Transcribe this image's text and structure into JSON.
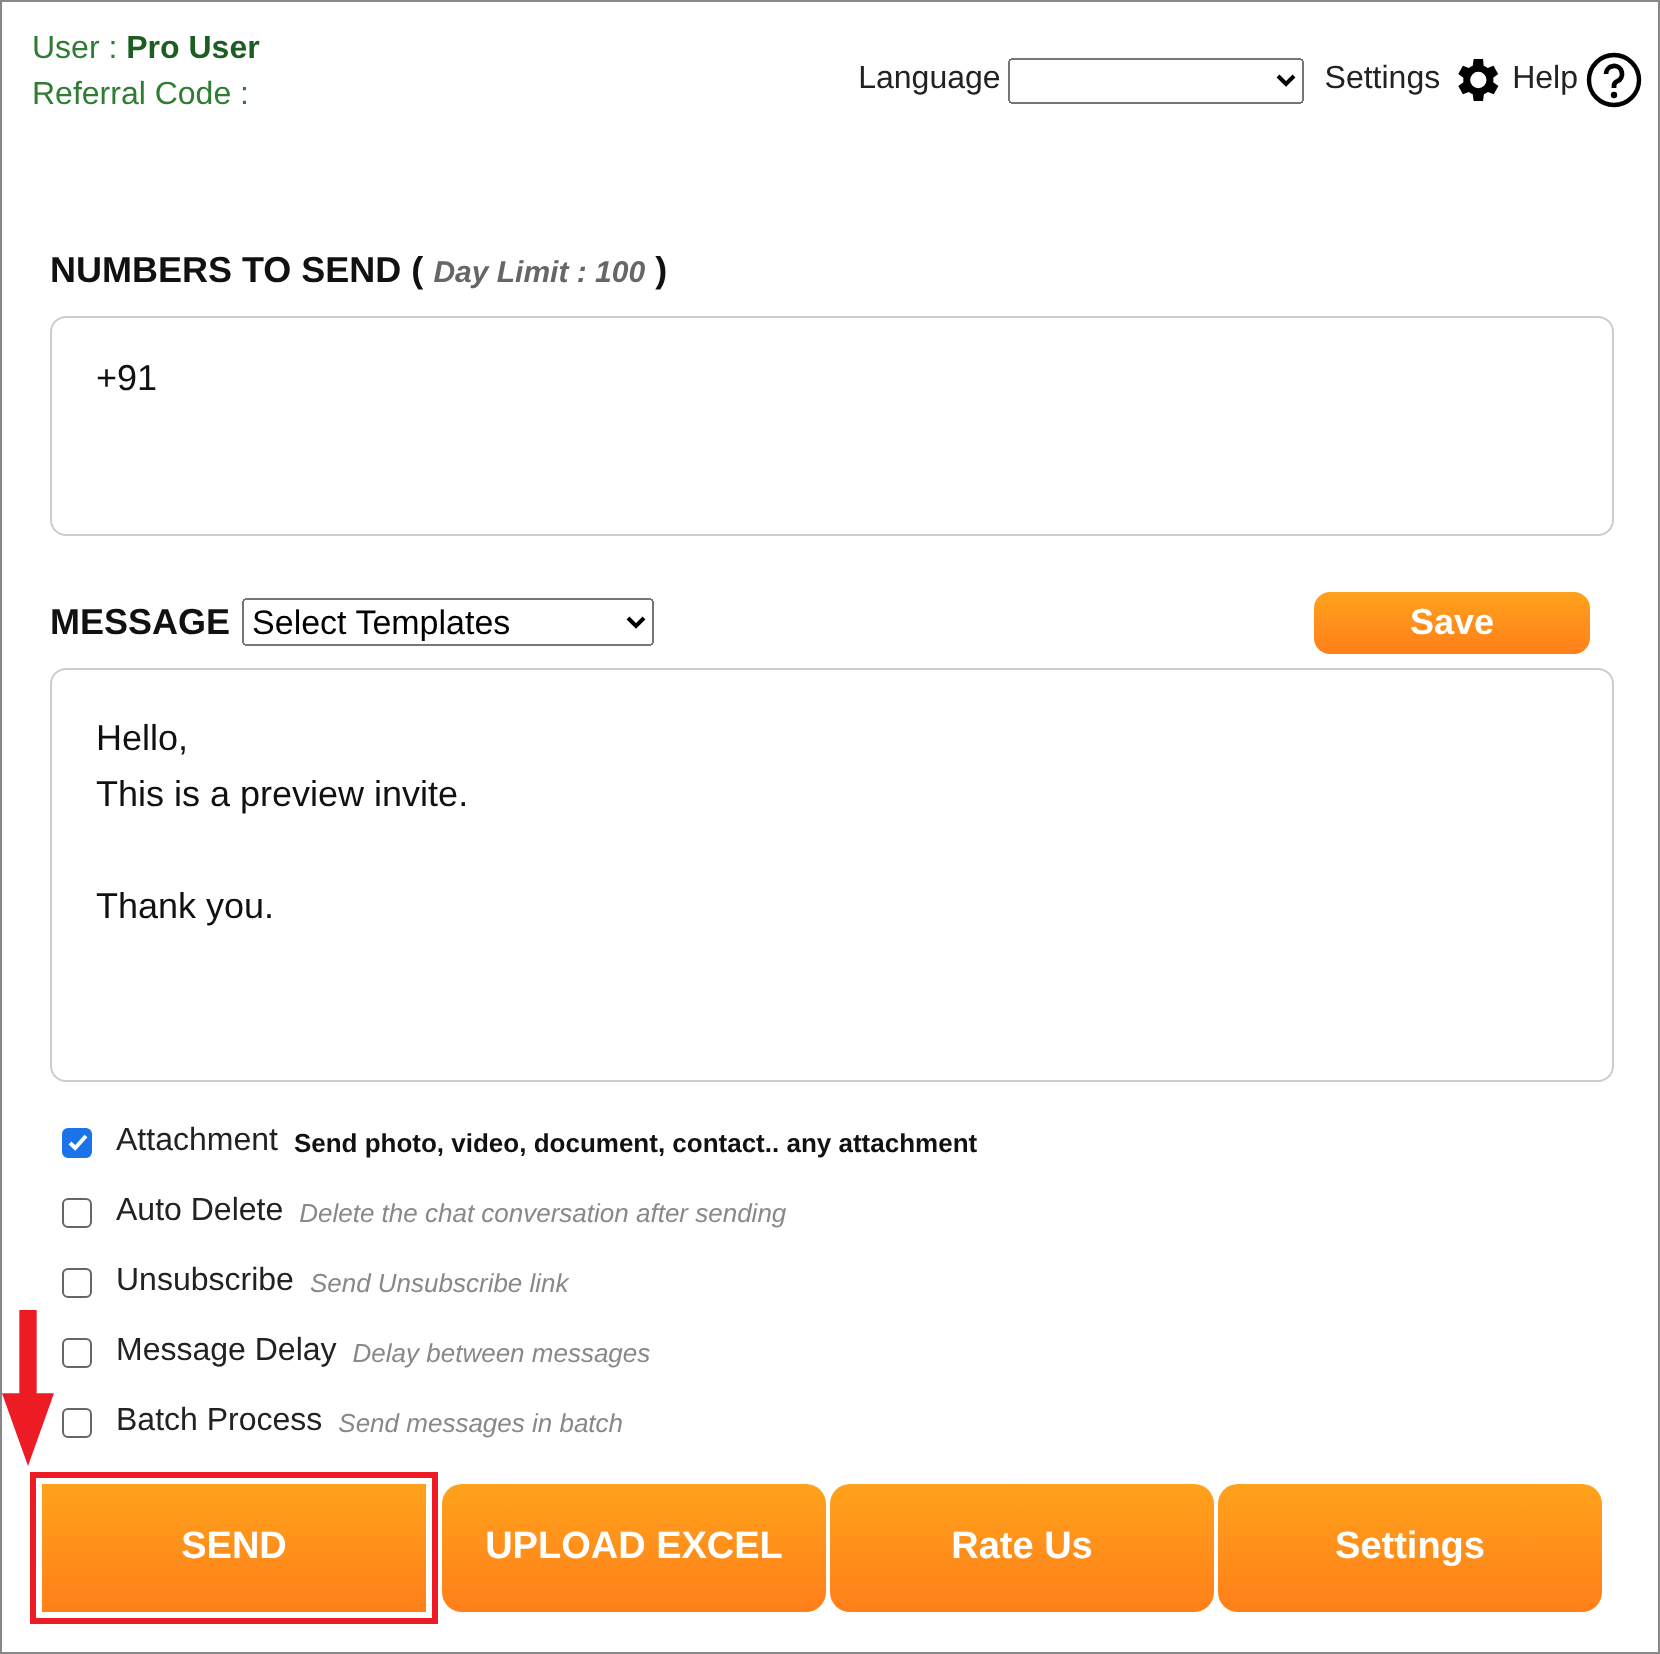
{
  "header": {
    "user_label": "User :",
    "user_name": "Pro User",
    "referral_label": "Referral Code :",
    "language_label": "Language",
    "settings_label": "Settings",
    "help_label": "Help"
  },
  "numbers": {
    "title": "NUMBERS TO SEND (",
    "limit": "Day Limit : 100",
    "close": ")",
    "value": "+91"
  },
  "message": {
    "title": "MESSAGE",
    "template_select": "Select Templates",
    "save": "Save",
    "value": "Hello,\nThis is a preview invite.\n\nThank you."
  },
  "options": [
    {
      "label": "Attachment",
      "description": "Send photo, video, document, contact.. any attachment",
      "kind": "strong",
      "checked": true
    },
    {
      "label": "Auto Delete",
      "description": "Delete the chat conversation after sending",
      "kind": "hint",
      "checked": false
    },
    {
      "label": "Unsubscribe",
      "description": "Send Unsubscribe link",
      "kind": "hint",
      "checked": false
    },
    {
      "label": "Message Delay",
      "description": "Delay between messages",
      "kind": "hint",
      "checked": false
    },
    {
      "label": "Batch Process",
      "description": "Send messages in batch",
      "kind": "hint",
      "checked": false
    }
  ],
  "buttons": [
    {
      "label": "SEND",
      "highlighted": true
    },
    {
      "label": "UPLOAD EXCEL",
      "highlighted": false
    },
    {
      "label": "Rate Us",
      "highlighted": false
    },
    {
      "label": "Settings",
      "highlighted": false
    }
  ]
}
